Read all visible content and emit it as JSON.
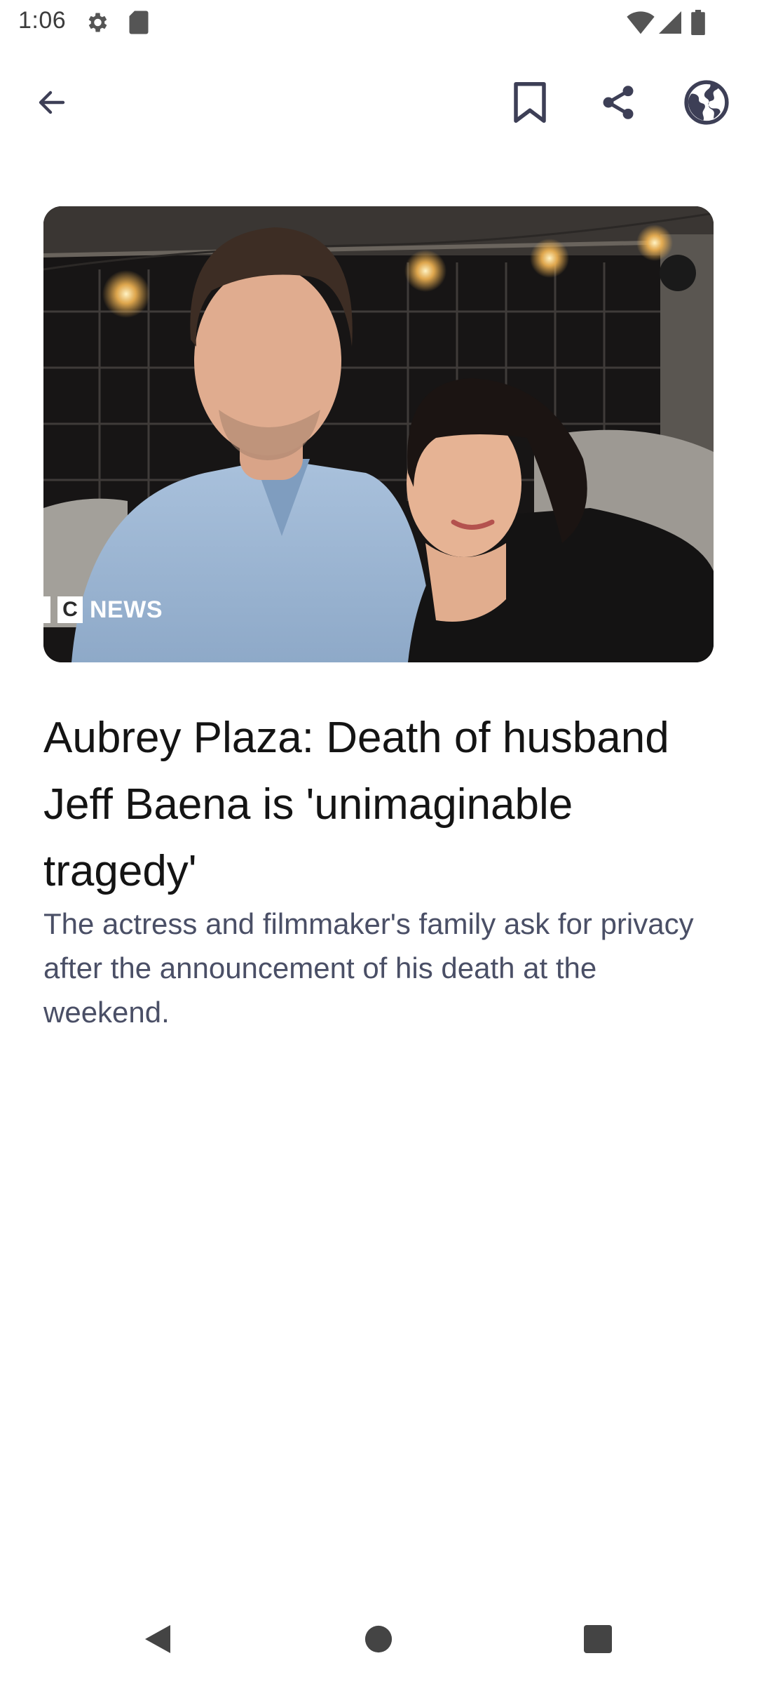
{
  "status_bar": {
    "time": "1:06",
    "icons": [
      "settings-icon",
      "sd-card-icon",
      "wifi-icon",
      "cell-signal-icon",
      "battery-icon"
    ]
  },
  "toolbar": {
    "icons": [
      "back-arrow-icon",
      "bookmark-icon",
      "share-icon",
      "globe-icon"
    ]
  },
  "article": {
    "image_watermark": "C NEWS",
    "headline": "Aubrey Plaza: Death of husband Jeff Baena is 'unimaginable tragedy'",
    "summary": "The actress and filmmaker's family ask for privacy after the announcement of his death at the weekend."
  },
  "nav_bar": {
    "icons": [
      "back-triangle-icon",
      "home-circle-icon",
      "recents-square-icon"
    ]
  },
  "colors": {
    "headline": "#141414",
    "summary": "#4a4f66",
    "icon": "#3d3f56"
  }
}
